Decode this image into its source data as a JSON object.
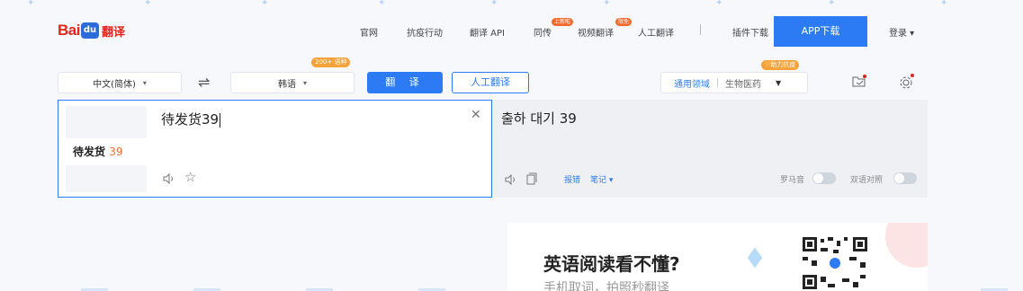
{
  "header": {
    "logo": {
      "text": "Bai",
      "paw": "du",
      "product": "翻译"
    },
    "nav": [
      {
        "label": "官网"
      },
      {
        "label": "抗疫行动"
      },
      {
        "label": "翻译 API"
      },
      {
        "label": "同传"
      },
      {
        "label": "视频翻译"
      },
      {
        "label": "人工翻译"
      },
      {
        "label": "插件下载"
      }
    ],
    "badges": {
      "tongchuan": "上新啦",
      "video": "限免"
    },
    "app_download": "APP下载",
    "login": "登录 ▾"
  },
  "langbar": {
    "source_lang": "中文(简体)",
    "target_lang": "韩语",
    "lang_count_tag": "200+ 语种",
    "translate_button": "翻 译",
    "human_button": "人工翻译",
    "domain_selected": "通用领域",
    "domain_option": "生物医药",
    "support_tag": "♡助力抗疫"
  },
  "source": {
    "text": "待发货39",
    "history_item_text": "待发货",
    "history_item_num": "39"
  },
  "target": {
    "text": "출하 대기 39",
    "report": "报错",
    "notes": "笔记 ▾",
    "romanization": "罗马音",
    "bilingual": "双语对照"
  },
  "ad": {
    "title": "英语阅读看不懂?",
    "subtitle": "手机取词，拍照秒翻译"
  },
  "colors": {
    "accent": "#2d7bf4",
    "brand_red": "#e1261c",
    "badge_orange": "#f26a2e"
  },
  "icons": [
    "swap-icon",
    "clear-icon",
    "speaker-icon",
    "star-icon",
    "copy-icon",
    "folder-icon",
    "gear-icon"
  ]
}
